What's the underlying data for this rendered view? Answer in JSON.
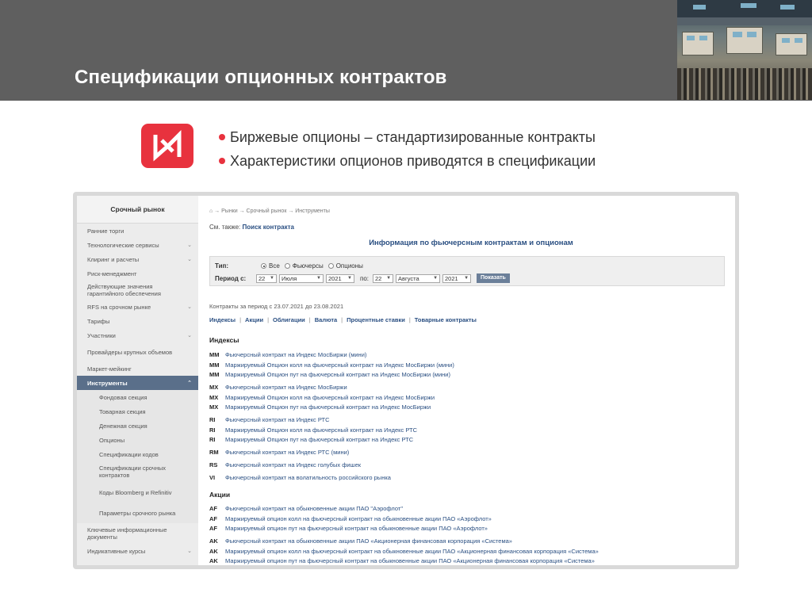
{
  "slide": {
    "title": "Спецификации опционных контрактов",
    "bullets": [
      "Биржевые опционы – стандартизированные контракты",
      "Характеристики опционов приводятся в спецификации"
    ],
    "colors": {
      "header_bg": "#5f5f5f",
      "logo_red": "#e8323e",
      "link_blue": "#2a4f82",
      "sidebar_active": "#5a6f8a"
    }
  },
  "site": {
    "sidebar": {
      "title": "Срочный рынок",
      "items": [
        "Ранние торги",
        "Технологические сервисы",
        "Клиринг и расчеты",
        "Риск-менеджмент",
        "Действующие значения гарантийного обеспечения",
        "RFS на срочном рынке",
        "Тарифы",
        "Участники",
        "Провайдеры крупных объемов",
        "Маркет-мейкинг",
        "Инструменты",
        "Фондовая секция",
        "Товарная секция",
        "Денежная секция",
        "Опционы",
        "Спецификации кодов",
        "Спецификации срочных контрактов",
        "Коды Bloomberg и Refinitiv",
        "Параметры срочного рынка",
        "Ключевые информационные документы",
        "Индикативные курсы"
      ]
    },
    "breadcrumb": "⌂ → Рынки → Срочный рынок → Инструменты",
    "see_also": {
      "label": "См. также:",
      "link": "Поиск контракта"
    },
    "info_title": "Информация по фьючерсным контрактам и опционам",
    "filter": {
      "type_label": "Тип:",
      "types": [
        "Все",
        "Фьючерсы",
        "Опционы"
      ],
      "period_label": "Период с:",
      "from": {
        "day": "22",
        "month": "Июля",
        "year": "2021"
      },
      "to_label": "по:",
      "to": {
        "day": "22",
        "month": "Августа",
        "year": "2021"
      },
      "show_button": "Показать"
    },
    "period_text": "Контракты за период с 23.07.2021 до 23.08.2021",
    "tabs": [
      "Индексы",
      "Акции",
      "Облигации",
      "Валюта",
      "Процентные ставки",
      "Товарные контракты"
    ],
    "sections": [
      {
        "title": "Индексы",
        "rows": [
          {
            "code": "MM",
            "text": "Фьючерсный контракт на Индекс МосБиржи (мини)"
          },
          {
            "code": "MM",
            "text": "Маржируемый Опцион колл на фьючерсный контракт на Индекс МосБиржи (мини)"
          },
          {
            "code": "MM",
            "text": "Маржируемый Опцион пут на фьючерсный контракт на Индекс МосБиржи (мини)"
          },
          {
            "code": "MX",
            "text": "Фьючерсный контракт на Индекс МосБиржи"
          },
          {
            "code": "MX",
            "text": "Маржируемый Опцион колл на фьючерсный контракт на Индекс МосБиржи"
          },
          {
            "code": "MX",
            "text": "Маржируемый Опцион пут на фьючерсный контракт на Индекс МосБиржи"
          },
          {
            "code": "RI",
            "text": "Фьючерсный контракт на Индекс РТС"
          },
          {
            "code": "RI",
            "text": "Маржируемый Опцион колл на фьючерсный контракт на Индекс РТС"
          },
          {
            "code": "RI",
            "text": "Маржируемый Опцион пут на фьючерсный контракт на Индекс РТС"
          },
          {
            "code": "RM",
            "text": "Фьючерсный контракт на Индекс РТС (мини)"
          },
          {
            "code": "RS",
            "text": "Фьючерсный контракт на Индекс голубых фишек"
          },
          {
            "code": "VI",
            "text": "Фьючерсный контракт на волатильность российского рынка"
          }
        ]
      },
      {
        "title": "Акции",
        "rows": [
          {
            "code": "AF",
            "text": "Фьючерсный контракт на обыкновенные акции ПАО \"Аэрофлот\""
          },
          {
            "code": "AF",
            "text": "Маржируемый опцион колл на фьючерсный контракт на обыкновенные акции ПАО «Аэрофлот»"
          },
          {
            "code": "AF",
            "text": "Маржируемый опцион пут на фьючерсный контракт на обыкновенные акции ПАО «Аэрофлот»"
          },
          {
            "code": "AK",
            "text": "Фьючерсный контракт на обыкновенные акции ПАО «Акционерная финансовая корпорация «Система»"
          },
          {
            "code": "AK",
            "text": "Маржируемый опцион колл на фьючерсный контракт на обыкновенные акции ПАО «Акционерная финансовая корпорация «Система»"
          },
          {
            "code": "AK",
            "text": "Маржируемый опцион пут на фьючерсный контракт на обыкновенные акции ПАО «Акционерная финансовая корпорация «Система»"
          }
        ]
      }
    ]
  }
}
